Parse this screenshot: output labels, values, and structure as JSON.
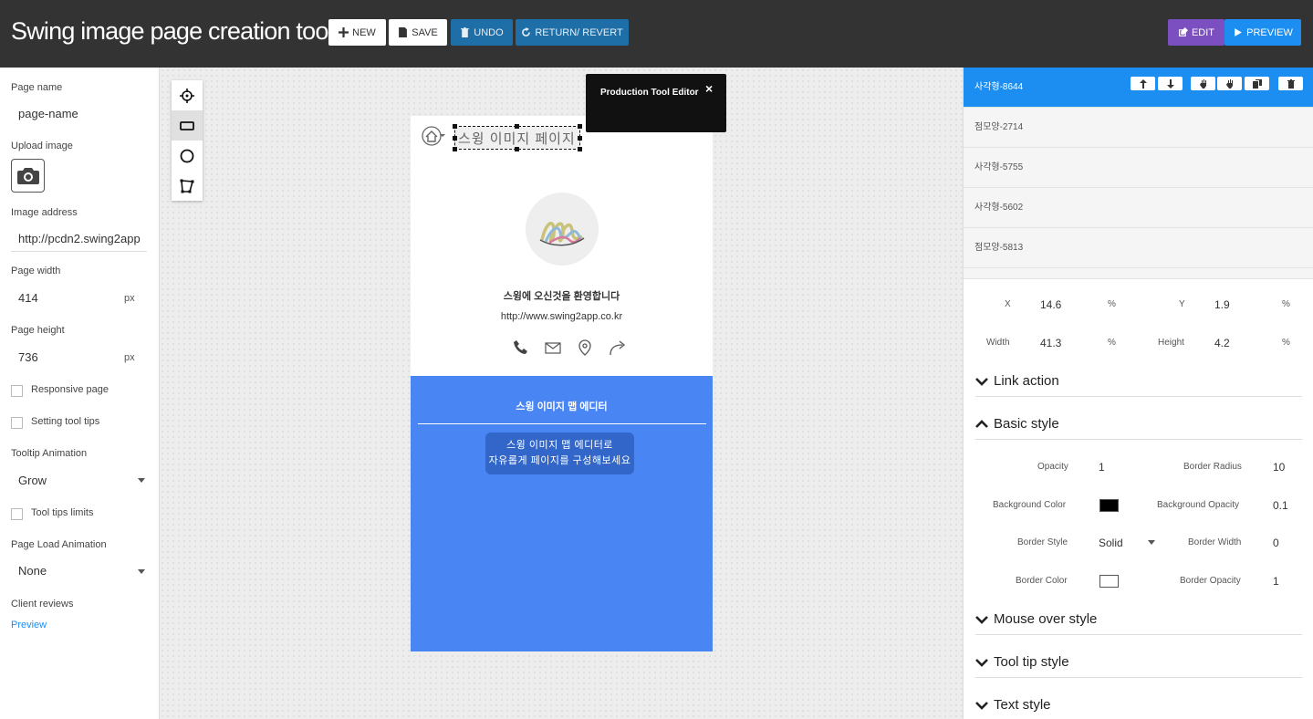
{
  "header": {
    "title": "Swing image page creation tool",
    "new_label": "NEW",
    "save_label": "SAVE",
    "undo_label": "UNDO",
    "revert_label": "RETURN/ REVERT",
    "edit_label": "EDIT",
    "preview_label": "PREVIEW"
  },
  "left": {
    "page_name_label": "Page name",
    "page_name_value": "page-name",
    "upload_label": "Upload image",
    "image_address_label": "Image address",
    "image_address_value": "http://pcdn2.swing2app",
    "page_width_label": "Page width",
    "page_width_value": "414",
    "page_height_label": "Page height",
    "page_height_value": "736",
    "unit": "px",
    "responsive_label": "Responsive page",
    "tooltips_label": "Setting tool tips",
    "tooltip_anim_label": "Tooltip Animation",
    "tooltip_anim_value": "Grow",
    "tooltips_limits_label": "Tool tips limits",
    "page_load_anim_label": "Page Load Animation",
    "page_load_anim_value": "None",
    "client_reviews_label": "Client reviews",
    "preview_link": "Preview"
  },
  "canvas": {
    "selected_text": "스윙 이미지 페이지",
    "welcome": "스윙에 오신것을 환영합니다",
    "url": "http://www.swing2app.co.kr",
    "blue_title": "스윙 이미지 맵 에디터",
    "blue_box_line1": "스윙 이미지 맵 에디터로",
    "blue_box_line2": "자유롭게 페이지를 구성해보세요",
    "popup_title": "Production Tool Editor",
    "popup_close": "×"
  },
  "right": {
    "layers": [
      {
        "label": "사각형-8644"
      },
      {
        "label": "점모양-2714"
      },
      {
        "label": "사각형-5755"
      },
      {
        "label": "사각형-5602"
      },
      {
        "label": "점모양-5813"
      }
    ],
    "x_label": "X",
    "x_value": "14.6",
    "y_label": "Y",
    "y_value": "1.9",
    "width_label": "Width",
    "width_value": "41.3",
    "height_label": "Height",
    "height_value": "4.2",
    "percent": "%",
    "link_action": "Link action",
    "basic_style": "Basic style",
    "opacity_label": "Opacity",
    "opacity_value": "1",
    "border_radius_label": "Border Radius",
    "border_radius_value": "10",
    "bg_color_label": "Background Color",
    "bg_opacity_label": "Background Opacity",
    "bg_opacity_value": "0.1",
    "border_style_label": "Border Style",
    "border_style_value": "Solid",
    "border_width_label": "Border Width",
    "border_width_value": "0",
    "border_color_label": "Border Color",
    "border_opacity_label": "Border Opacity",
    "border_opacity_value": "1",
    "mouse_over_style": "Mouse over style",
    "tool_tip_style": "Tool tip style",
    "text_style": "Text style"
  },
  "colors": {
    "header_bg": "#333333",
    "accent_blue": "#1c8ef2",
    "edit_purple": "#7b4fbf",
    "phone_blue": "#4a86f3",
    "bg_color_swatch": "#000000",
    "border_color_swatch": "#ffffff"
  }
}
